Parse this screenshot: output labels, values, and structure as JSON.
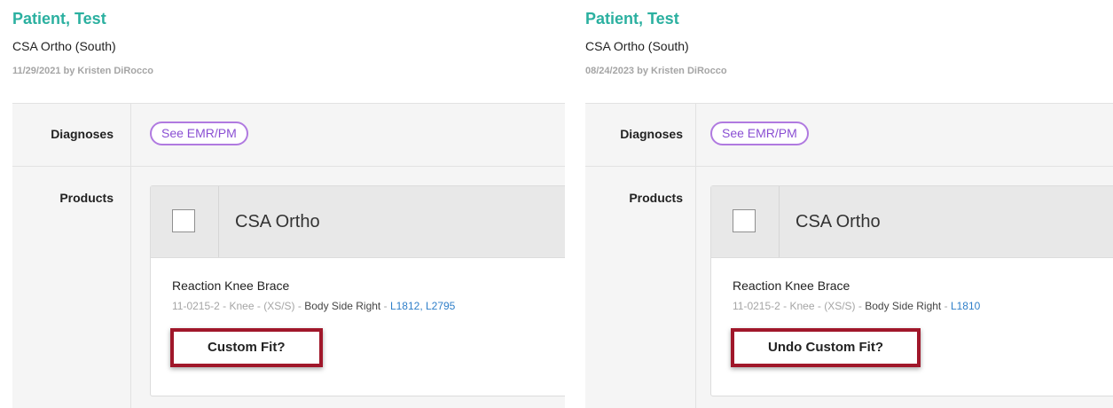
{
  "left": {
    "patient_name": "Patient, Test",
    "practice": "CSA Ortho (South)",
    "date_by": "11/29/2021 by Kristen DiRocco",
    "diagnoses_label": "Diagnoses",
    "see_emr_label": "See EMR/PM",
    "products_label": "Products",
    "vendor": "CSA Ortho",
    "product_name": "Reaction Knee Brace",
    "product_code": "11-0215-2",
    "product_body": "Knee",
    "product_size": "(XS/S)",
    "body_side": "Body Side Right",
    "hcpcs": "L1812, L2795",
    "action_label": "Custom Fit?"
  },
  "right": {
    "patient_name": "Patient, Test",
    "practice": "CSA Ortho (South)",
    "date_by": "08/24/2023 by Kristen DiRocco",
    "diagnoses_label": "Diagnoses",
    "see_emr_label": "See EMR/PM",
    "products_label": "Products",
    "vendor": "CSA Ortho",
    "product_name": "Reaction Knee Brace",
    "product_code": "11-0215-2",
    "product_body": "Knee",
    "product_size": "(XS/S)",
    "body_side": "Body Side Right",
    "hcpcs": "L1810",
    "action_label": "Undo Custom Fit?"
  },
  "colors": {
    "name_teal": "#2bb0a0",
    "pill_purple": "#8a4fd3",
    "link_blue": "#2f7fc9",
    "highlight_red": "#a0172a"
  }
}
